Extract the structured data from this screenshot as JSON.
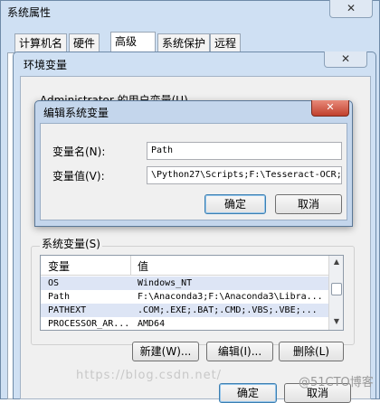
{
  "outer_window": {
    "title": "系统属性",
    "close_glyph": "✕",
    "tabs": [
      {
        "label": "计算机名"
      },
      {
        "label": "硬件"
      },
      {
        "label": "高级"
      },
      {
        "label": "系统保护"
      },
      {
        "label": "远程"
      }
    ],
    "ok_label": "确定",
    "cancel_label": "取消"
  },
  "env_window": {
    "title": "环境变量",
    "close_glyph": "✕",
    "user_group_label": "Administrator 的用户变量(U)",
    "system_group_label": "系统变量(S)",
    "columns": [
      "变量",
      "值"
    ],
    "rows": [
      {
        "name": "OS",
        "value": "Windows_NT",
        "selected": true
      },
      {
        "name": "Path",
        "value": "F:\\Anaconda3;F:\\Anaconda3\\Libra...",
        "selected": false
      },
      {
        "name": "PATHEXT",
        "value": ".COM;.EXE;.BAT;.CMD;.VBS;.VBE;...",
        "selected": true
      },
      {
        "name": "PROCESSOR_AR...",
        "value": "AMD64",
        "selected": false
      }
    ],
    "new_label": "新建(W)...",
    "edit_label": "编辑(I)...",
    "delete_label": "删除(L)"
  },
  "edit_dialog": {
    "title": "编辑系统变量",
    "close_glyph": "✕",
    "name_label": "变量名(N):",
    "name_value": "Path",
    "value_label": "变量值(V):",
    "value_value": "\\Python27\\Scripts;F:\\Tesseract-OCR;",
    "ok_label": "确定",
    "cancel_label": "取消"
  },
  "watermark": {
    "url": "https://blog.csdn.net/",
    "brand": "@51CTO博客"
  }
}
